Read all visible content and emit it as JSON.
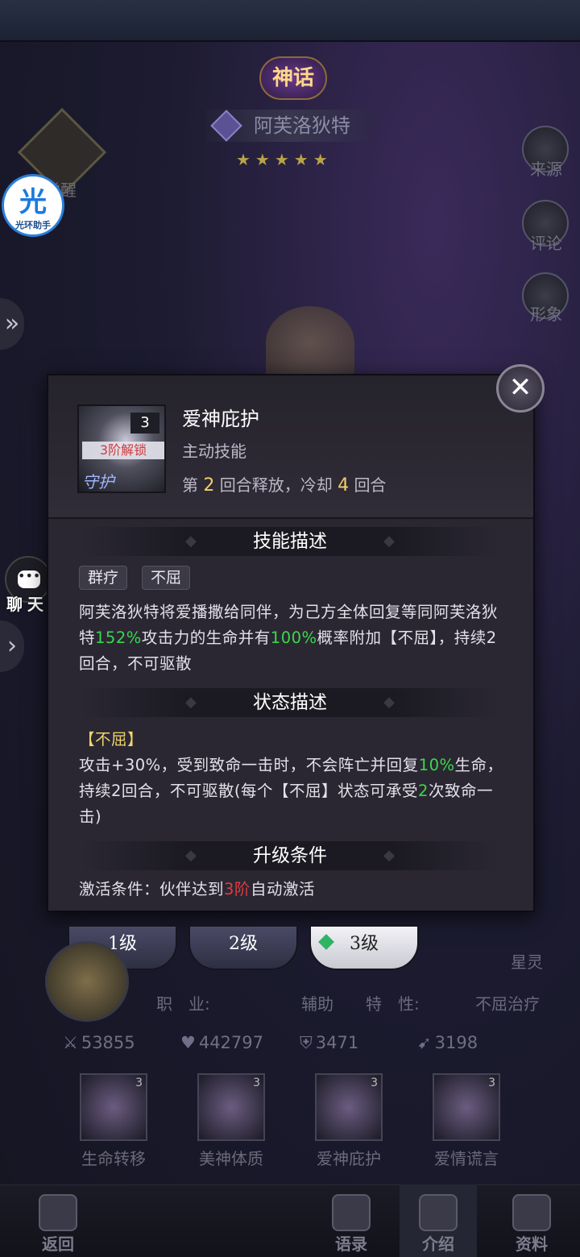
{
  "header": {
    "rarity_badge": "神话",
    "hero_name": "阿芙洛狄特",
    "stars": "★★★★★",
    "awaken_label": "觉醒"
  },
  "side_menu": {
    "source": "来源",
    "comment": "评论",
    "appearance": "形象"
  },
  "assistant": {
    "big": "光",
    "small": "光环助手"
  },
  "chat": {
    "label": "聊天",
    "bubble": "•••"
  },
  "popup": {
    "skill": {
      "name": "爱神庇护",
      "type": "主动技能",
      "level": "3",
      "unlock": "3阶解锁",
      "icon_text": "守护",
      "cd_prefix": "第",
      "cd_round": "2",
      "cd_mid": "回合释放，冷却",
      "cd_cool": "4",
      "cd_suffix": "回合"
    },
    "close_icon": "✕",
    "sections": {
      "skill_desc_title": "技能描述",
      "status_desc_title": "状态描述",
      "upgrade_title": "升级条件"
    },
    "tags": [
      "群疗",
      "不屈"
    ],
    "skill_desc": {
      "p1": "阿芙洛狄特将爱播撒给同伴，为己方全体回复等同阿芙洛狄特",
      "v1": "152%",
      "p2": "攻击力的生命并有",
      "v2": "100%",
      "p3": "概率附加【不屈】，持续2回合，不可驱散"
    },
    "status_desc": {
      "title": "【不屈】",
      "p1": "攻击+30%，受到致命一击时，不会阵亡并回复",
      "v1": "10%",
      "p2": "生命，持续2回合，不可驱散(每个【不屈】状态可承受",
      "v2": "2",
      "p3": "次致命一击)"
    },
    "upgrade": {
      "p1": "激活条件：伙伴达到",
      "v1": "3阶",
      "p2": "自动激活"
    }
  },
  "level_tabs": [
    "1级",
    "2级",
    "3级"
  ],
  "hero_info": {
    "race_value": "星灵",
    "job_label": "职　业:",
    "job_value": "辅助",
    "trait_label": "特　性:",
    "trait_value": "不屈治疗"
  },
  "stats": {
    "attack": "53855",
    "hp": "442797",
    "defense": "3471",
    "speed": "3198"
  },
  "skills": [
    {
      "name": "生命转移",
      "level": "3"
    },
    {
      "name": "美神体质",
      "level": "3"
    },
    {
      "name": "爱神庇护",
      "level": "3"
    },
    {
      "name": "爱情谎言",
      "level": "3"
    }
  ],
  "bottom_nav": {
    "back": "返回",
    "quotes": "语录",
    "intro": "介绍",
    "profile": "资料"
  },
  "colors": {
    "highlight_green": "#3ad84a",
    "highlight_red": "#e23c3c",
    "highlight_yellow": "#f0cf6a"
  }
}
